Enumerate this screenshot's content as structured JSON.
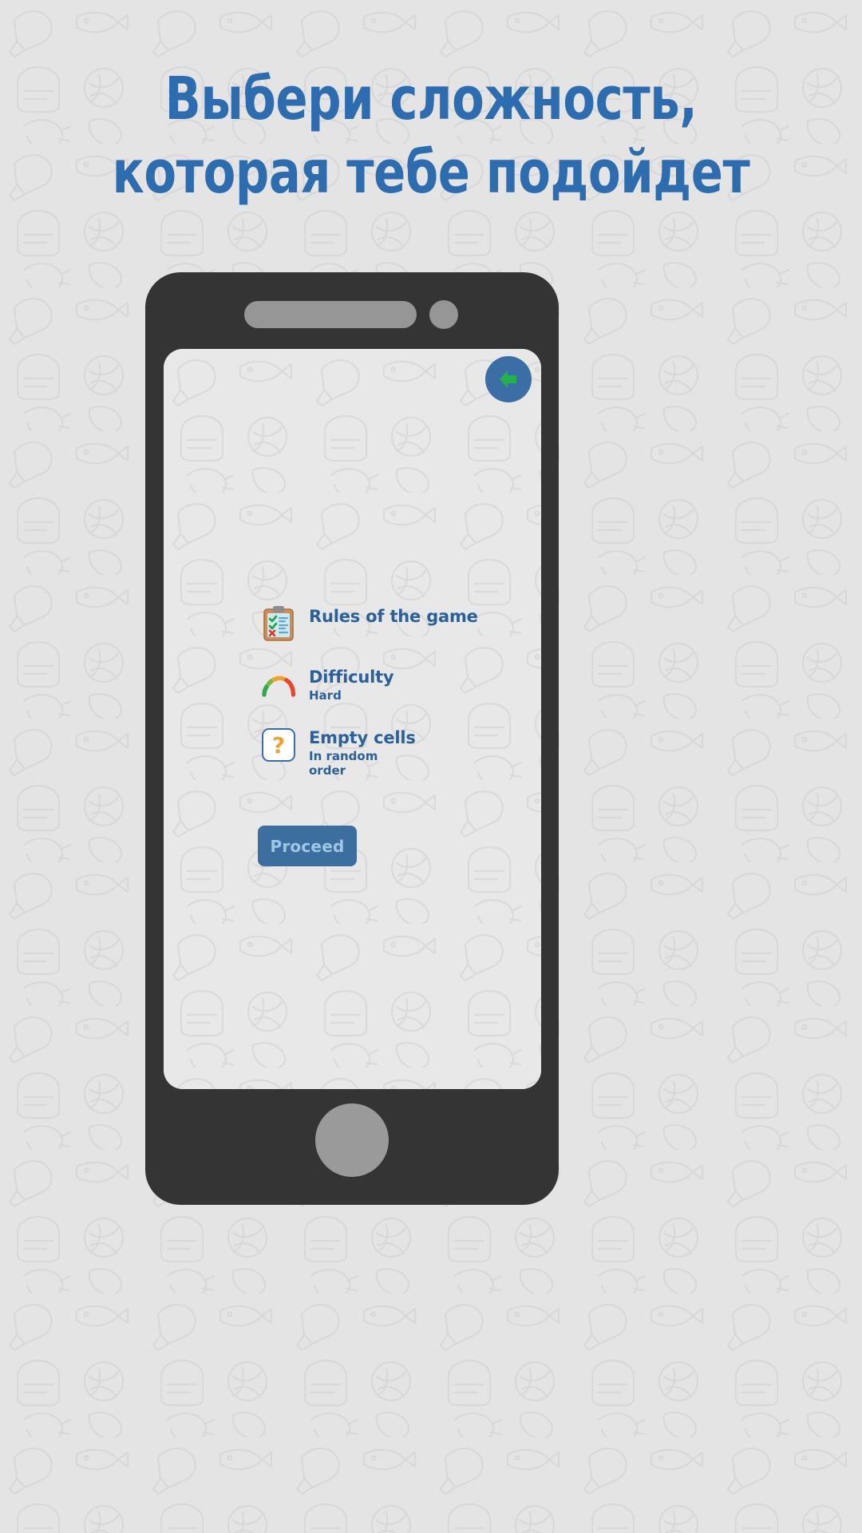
{
  "page": {
    "background_color": "#e4e4e4",
    "pattern": "food-doodle-outline-pattern"
  },
  "headline": {
    "line1": "Выбери сложность,",
    "line2": "которая тебе подойдет",
    "color": "#2e6cb0"
  },
  "phone": {
    "body_color": "#343434",
    "speaker_name": "phone-speaker",
    "camera_name": "phone-camera",
    "home_button_name": "phone-home-button",
    "screen_background": "#e8e8e8"
  },
  "screen": {
    "back_button": {
      "icon": "back-arrow-icon",
      "circle_color": "#3a6ea5",
      "arrow_color": "#22b14c"
    },
    "menu": [
      {
        "icon": "clipboard-checklist-icon",
        "title": "Rules of the game",
        "subtitle": ""
      },
      {
        "icon": "difficulty-gauge-icon",
        "title": "Difficulty",
        "subtitle": "Hard"
      },
      {
        "icon": "question-mark-icon",
        "title": "Empty cells",
        "subtitle": "In random order"
      }
    ],
    "proceed": {
      "label": "Proceed",
      "fill_color": "#3c6e9f",
      "text_color": "#9ec7e4"
    }
  }
}
